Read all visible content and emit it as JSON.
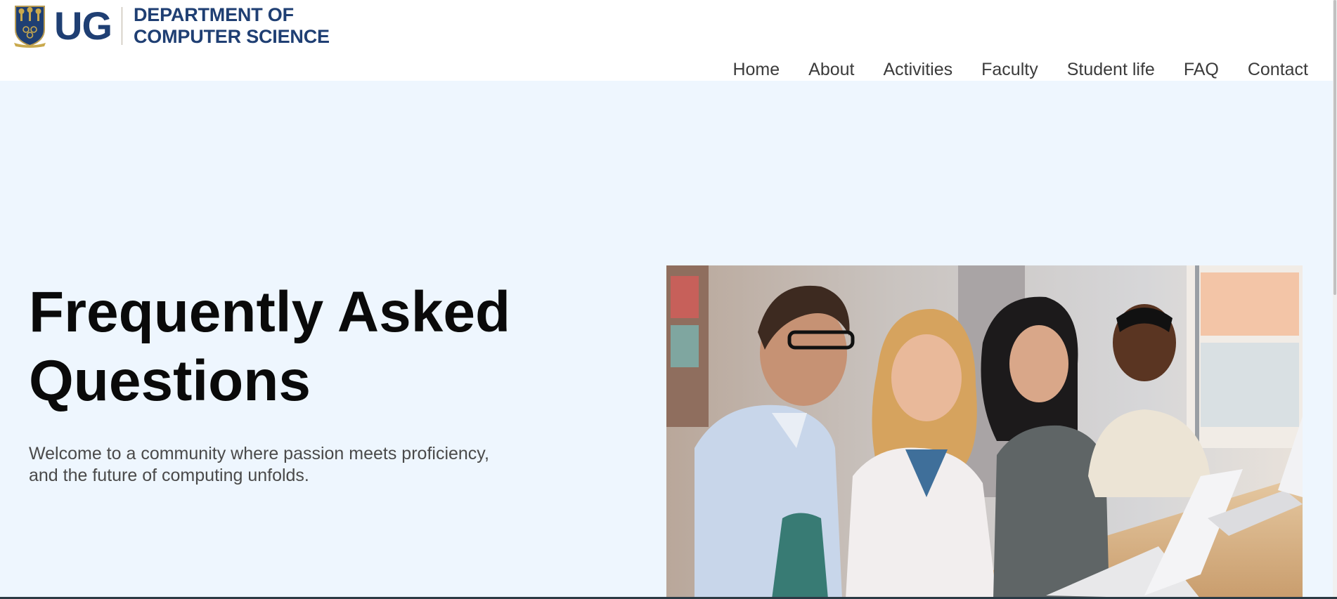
{
  "brand": {
    "short": "UG",
    "dept_line1": "DEPARTMENT OF",
    "dept_line2": "COMPUTER SCIENCE"
  },
  "nav": {
    "items": [
      {
        "label": "Home"
      },
      {
        "label": "About"
      },
      {
        "label": "Activities"
      },
      {
        "label": "Faculty"
      },
      {
        "label": "Student life"
      },
      {
        "label": "FAQ"
      },
      {
        "label": "Contact"
      }
    ]
  },
  "hero": {
    "title_line1": "Frequently Asked",
    "title_line2": "Questions",
    "subtitle_line1": "Welcome to a community where passion meets proficiency,",
    "subtitle_line2": "and the future of computing unfolds."
  },
  "colors": {
    "brand_navy": "#1f3f73",
    "hero_background": "#eef6fe",
    "nav_text": "#3b3b3b"
  }
}
